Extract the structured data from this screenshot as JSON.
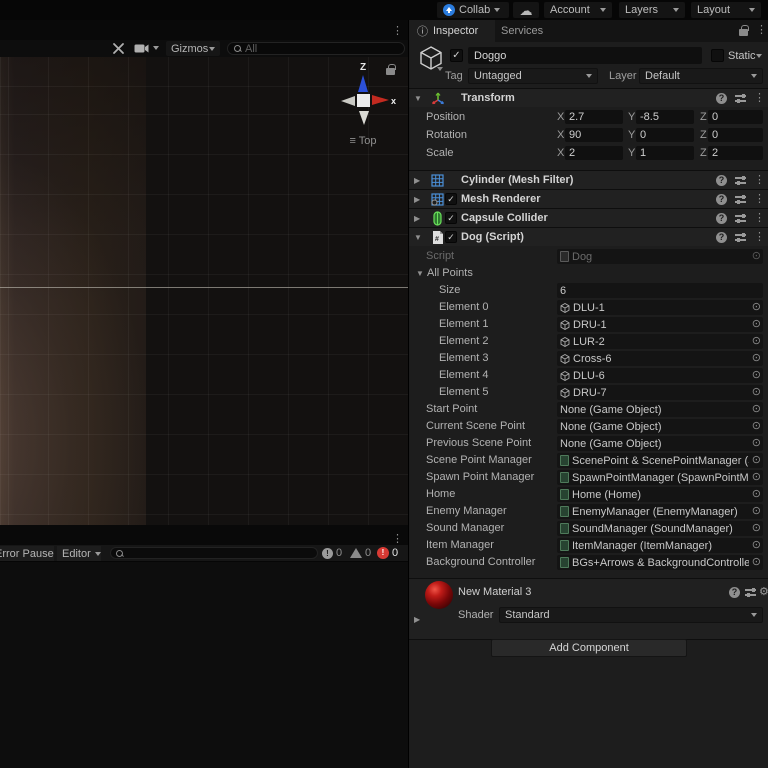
{
  "topbar": {
    "collab": "Collab",
    "account": "Account",
    "layers": "Layers",
    "layout": "Layout"
  },
  "scene_view": {
    "gizmos_label": "Gizmos",
    "search_placeholder": "All",
    "axis_up": "Z",
    "axis_right": "x",
    "view_label": "Top"
  },
  "console": {
    "error_pause_label": "Error Pause",
    "editor_label": "Editor",
    "info_count": "0",
    "warning_count": "0",
    "error_count": "0"
  },
  "inspector": {
    "tab_inspector": "Inspector",
    "tab_services": "Services",
    "header": {
      "name": "Doggo",
      "static_label": "Static",
      "tag_label": "Tag",
      "tag_value": "Untagged",
      "layer_label": "Layer",
      "layer_value": "Default"
    },
    "transform": {
      "title": "Transform",
      "axis_x": "X",
      "axis_y": "Y",
      "axis_z": "Z",
      "position": {
        "label": "Position",
        "x": "2.7",
        "y": "-8.5",
        "z": "0"
      },
      "rotation": {
        "label": "Rotation",
        "x": "90",
        "y": "0",
        "z": "0"
      },
      "scale": {
        "label": "Scale",
        "x": "2",
        "y": "1",
        "z": "2"
      }
    },
    "components": {
      "mesh_filter": "Cylinder (Mesh Filter)",
      "mesh_renderer": "Mesh Renderer",
      "capsule_collider": "Capsule Collider",
      "dog_script": "Dog (Script)"
    },
    "script": {
      "script_label": "Script",
      "script_value": "Dog",
      "all_points_label": "All Points",
      "size_label": "Size",
      "size_value": "6",
      "elements": [
        {
          "label": "Element 0",
          "value": "DLU-1"
        },
        {
          "label": "Element 1",
          "value": "DRU-1"
        },
        {
          "label": "Element 2",
          "value": "LUR-2"
        },
        {
          "label": "Element 3",
          "value": "Cross-6"
        },
        {
          "label": "Element 4",
          "value": "DLU-6"
        },
        {
          "label": "Element 5",
          "value": "DRU-7"
        }
      ],
      "fields": [
        {
          "label": "Start Point",
          "value": "None (Game Object)"
        },
        {
          "label": "Current Scene Point",
          "value": "None (Game Object)"
        },
        {
          "label": "Previous Scene Point",
          "value": "None (Game Object)"
        },
        {
          "label": "Scene Point Manager",
          "value": "ScenePoint & ScenePointManager (Sc"
        },
        {
          "label": "Spawn Point Manager",
          "value": "SpawnPointManager (SpawnPointMa"
        },
        {
          "label": "Home",
          "value": "Home (Home)"
        },
        {
          "label": "Enemy Manager",
          "value": "EnemyManager (EnemyManager)"
        },
        {
          "label": "Sound Manager",
          "value": "SoundManager (SoundManager)"
        },
        {
          "label": "Item Manager",
          "value": "ItemManager (ItemManager)"
        },
        {
          "label": "Background Controller",
          "value": "BGs+Arrows & BackgroundController ("
        }
      ]
    },
    "material": {
      "title": "New Material 3",
      "shader_label": "Shader",
      "shader_value": "Standard"
    },
    "add_component_label": "Add Component"
  }
}
